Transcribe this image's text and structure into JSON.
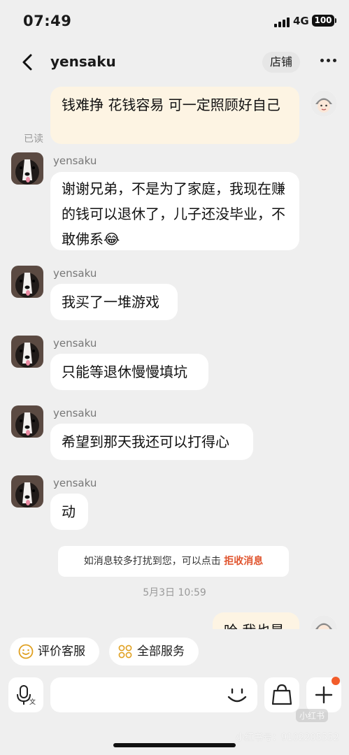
{
  "status_bar": {
    "time": "07:49",
    "network": "4G",
    "battery": "100"
  },
  "nav": {
    "title": "yensaku",
    "shop_button": "店铺"
  },
  "chat": {
    "my_message_1": "钱难挣 花钱容易 可一定照顾好自己",
    "read_status": "已读",
    "sender_name": "yensaku",
    "messages": [
      {
        "sender": "yensaku",
        "text": "谢谢兄弟，不是为了家庭，我现在赚的钱可以退休了，儿子还没毕业，不敢佛系😂"
      },
      {
        "sender": "yensaku",
        "text": "我买了一堆游戏"
      },
      {
        "sender": "yensaku",
        "text": "只能等退休慢慢填坑"
      },
      {
        "sender": "yensaku",
        "text": "希望到那天我还可以打得心"
      },
      {
        "sender": "yensaku",
        "text": "动"
      }
    ],
    "notice_text": "如消息较多打扰到您，可以点击",
    "notice_link": "拒收消息",
    "date": "5月3日 10:59",
    "my_message_2_partial": "哈 我也是"
  },
  "quick_actions": {
    "review": "评价客服",
    "all_services": "全部服务"
  },
  "input": {
    "placeholder": ""
  },
  "watermark": {
    "logo": "小红书",
    "id_line": "小红书号：9102205552"
  },
  "colors": {
    "accent": "#e0552f",
    "my_bubble": "#fdf4e3",
    "background": "#efefef"
  },
  "icons": [
    "back-icon",
    "more-icon",
    "smile-icon",
    "grid-icon",
    "voice-icon",
    "emoji-icon",
    "bag-icon",
    "plus-icon"
  ]
}
